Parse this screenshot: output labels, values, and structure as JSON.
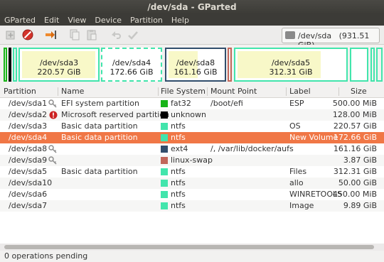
{
  "window": {
    "title": "/dev/sda - GParted"
  },
  "menu": [
    "GParted",
    "Edit",
    "View",
    "Device",
    "Partition",
    "Help"
  ],
  "device": {
    "label": "/dev/sda",
    "size": "(931.51 GiB)"
  },
  "map": {
    "sda3": {
      "name": "/dev/sda3",
      "size": "220.57 GiB"
    },
    "sda4": {
      "name": "/dev/sda4",
      "size": "172.66 GiB"
    },
    "sda8": {
      "name": "/dev/sda8",
      "size": "161.16 GiB"
    },
    "sda5": {
      "name": "/dev/sda5",
      "size": "312.31 GiB"
    }
  },
  "columns": [
    "Partition",
    "Name",
    "File System",
    "Mount Point",
    "Label",
    "Size"
  ],
  "rows": [
    {
      "partition": "/dev/sda1",
      "name": "EFI system partition",
      "fs": "fat32",
      "fs_color": "#18b418",
      "mount": "/boot/efi",
      "label": "ESP",
      "size": "500.00 MiB",
      "icon": "key-icon"
    },
    {
      "partition": "/dev/sda2",
      "name": "Microsoft reserved partition",
      "fs": "unknown",
      "fs_color": "#000000",
      "mount": "",
      "label": "",
      "size": "128.00 MiB",
      "icon": "error-icon"
    },
    {
      "partition": "/dev/sda3",
      "name": "Basic data partition",
      "fs": "ntfs",
      "fs_color": "#42e5ac",
      "mount": "",
      "label": "OS",
      "size": "220.57 GiB",
      "icon": ""
    },
    {
      "partition": "/dev/sda4",
      "name": "Basic data partition",
      "fs": "ntfs",
      "fs_color": "#42e5ac",
      "mount": "",
      "label": "New Volume",
      "size": "172.66 GiB",
      "icon": ""
    },
    {
      "partition": "/dev/sda8",
      "name": "",
      "fs": "ext4",
      "fs_color": "#314e6c",
      "mount": "/, /var/lib/docker/aufs",
      "label": "",
      "size": "161.16 GiB",
      "icon": "key-icon"
    },
    {
      "partition": "/dev/sda9",
      "name": "",
      "fs": "linux-swap",
      "fs_color": "#c1665a",
      "mount": "",
      "label": "",
      "size": "3.87 GiB",
      "icon": "key-icon"
    },
    {
      "partition": "/dev/sda5",
      "name": "Basic data partition",
      "fs": "ntfs",
      "fs_color": "#42e5ac",
      "mount": "",
      "label": "Files",
      "size": "312.31 GiB",
      "icon": ""
    },
    {
      "partition": "/dev/sda10",
      "name": "",
      "fs": "ntfs",
      "fs_color": "#42e5ac",
      "mount": "",
      "label": "allo",
      "size": "50.00 GiB",
      "icon": ""
    },
    {
      "partition": "/dev/sda6",
      "name": "",
      "fs": "ntfs",
      "fs_color": "#42e5ac",
      "mount": "",
      "label": "WINRETOOLS",
      "size": "450.00 MiB",
      "icon": ""
    },
    {
      "partition": "/dev/sda7",
      "name": "",
      "fs": "ntfs",
      "fs_color": "#42e5ac",
      "mount": "",
      "label": "Image",
      "size": "9.89 GiB",
      "icon": ""
    }
  ],
  "selected_row": 3,
  "status": {
    "text": "0 operations pending"
  },
  "colors": {
    "accent": "#f07746",
    "ntfs": "#42e5ac",
    "ext4": "#314e6c",
    "fat32": "#18b418"
  }
}
